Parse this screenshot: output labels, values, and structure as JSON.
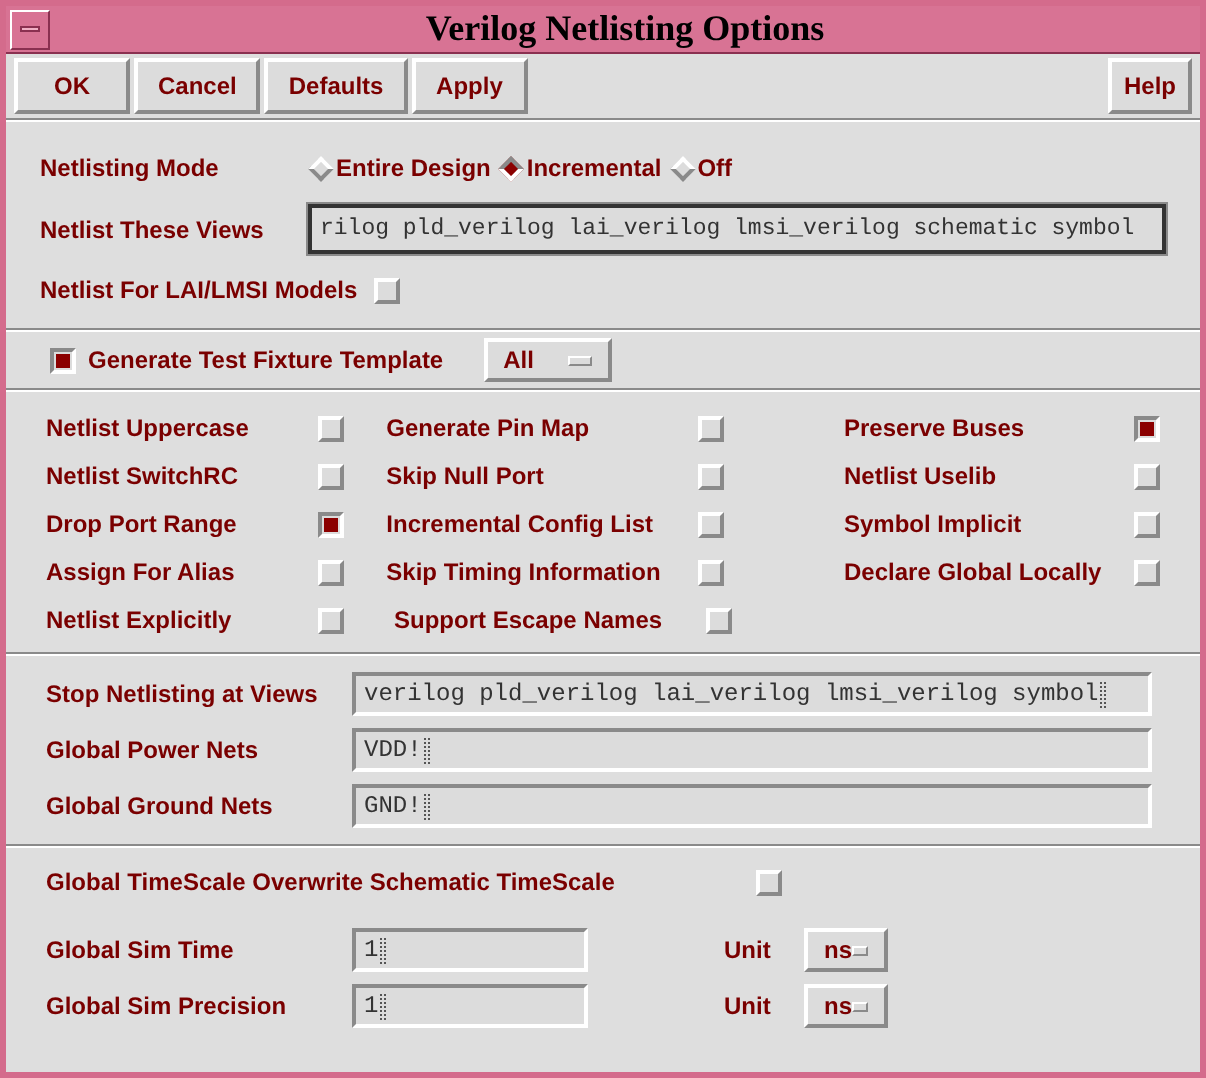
{
  "window": {
    "title": "Verilog Netlisting Options"
  },
  "buttons": [
    {
      "label": "OK"
    },
    {
      "label": "Cancel"
    },
    {
      "label": "Defaults"
    },
    {
      "label": "Apply"
    }
  ],
  "help_button": {
    "label": "Help"
  },
  "netlisting_mode": {
    "label": "Netlisting Mode",
    "options": [
      {
        "label": "Entire Design",
        "selected": false
      },
      {
        "label": "Incremental",
        "selected": true
      },
      {
        "label": "Off",
        "selected": false
      }
    ]
  },
  "netlist_these_views": {
    "label": "Netlist These Views",
    "value": "rilog pld_verilog lai_verilog lmsi_verilog schematic symbol"
  },
  "lai_lmsi_models": {
    "label": "Netlist For LAI/LMSI Models",
    "checked": false
  },
  "test_fixture": {
    "label": "Generate Test Fixture Template",
    "checked": true,
    "dropdown": "All"
  },
  "option_rows": [
    [
      {
        "label": "Netlist Uppercase",
        "checked": false
      },
      {
        "label": "Generate Pin Map",
        "checked": false
      },
      {
        "label": "Preserve Buses",
        "checked": true
      }
    ],
    [
      {
        "label": "Netlist SwitchRC",
        "checked": false
      },
      {
        "label": "Skip Null Port",
        "checked": false
      },
      {
        "label": "Netlist Uselib",
        "checked": false
      }
    ],
    [
      {
        "label": "Drop Port Range",
        "checked": true
      },
      {
        "label": "Incremental Config List",
        "checked": false
      },
      {
        "label": "Symbol Implicit",
        "checked": false
      }
    ],
    [
      {
        "label": "Assign For Alias",
        "checked": false
      },
      {
        "label": "Skip Timing Information",
        "checked": false
      },
      {
        "label": "Declare Global Locally",
        "checked": false
      }
    ],
    [
      {
        "label": "Netlist Explicitly",
        "checked": false
      },
      {
        "label": "Support Escape Names",
        "checked": false
      }
    ]
  ],
  "view_fields": [
    {
      "label": "Stop Netlisting at Views",
      "value": "verilog pld_verilog lai_verilog lmsi_verilog symbol"
    },
    {
      "label": "Global Power Nets",
      "value": "VDD!"
    },
    {
      "label": "Global Ground Nets",
      "value": "GND!"
    }
  ],
  "timescale_overwrite": {
    "label": "Global TimeScale Overwrite Schematic TimeScale",
    "checked": false
  },
  "sim_rows": [
    {
      "label": "Global Sim Time",
      "value": "1",
      "unit_label": "Unit",
      "unit": "ns"
    },
    {
      "label": "Global Sim Precision",
      "value": "1",
      "unit_label": "Unit",
      "unit": "ns"
    }
  ]
}
